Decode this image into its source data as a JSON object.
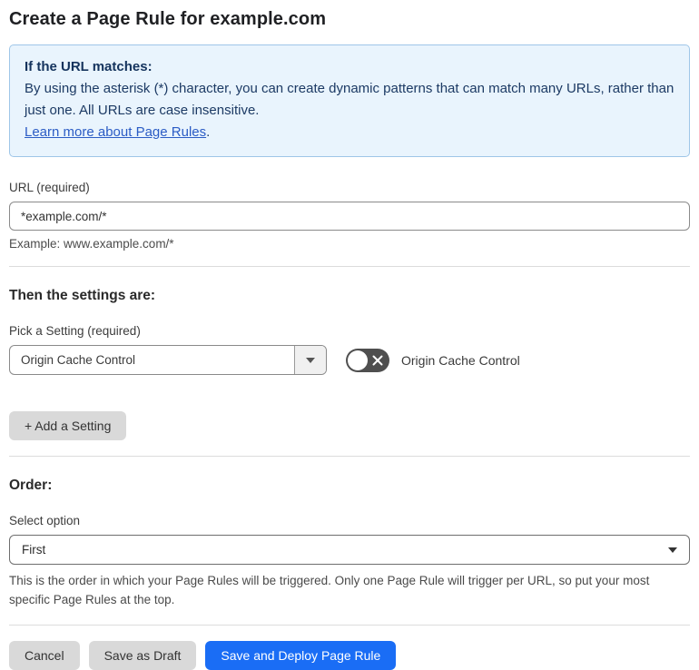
{
  "page": {
    "title": "Create a Page Rule for example.com"
  },
  "info_box": {
    "heading": "If the URL matches:",
    "body": "By using the asterisk (*) character, you can create dynamic patterns that can match many URLs, rather than just one. All URLs are case insensitive.",
    "link_label": "Learn more about Page Rules",
    "link_suffix": "."
  },
  "url_section": {
    "label": "URL (required)",
    "value": "*example.com/*",
    "helper": "Example: www.example.com/*"
  },
  "settings_section": {
    "heading": "Then the settings are:",
    "picker_label": "Pick a Setting (required)",
    "picker_value": "Origin Cache Control",
    "toggle_label": "Origin Cache Control",
    "toggle_state": "off",
    "add_button_label": "+ Add a Setting"
  },
  "order_section": {
    "heading": "Order:",
    "select_label": "Select option",
    "select_value": "First",
    "helper": "This is the order in which your Page Rules will be triggered. Only one Page Rule will trigger per URL, so put your most specific Page Rules at the top."
  },
  "footer": {
    "cancel_label": "Cancel",
    "save_draft_label": "Save as Draft",
    "save_deploy_label": "Save and Deploy Page Rule"
  },
  "colors": {
    "info_box_background": "#e9f4fd",
    "info_box_border": "#9fc6e8",
    "info_box_text": "#1c3a64",
    "link_blue": "#2b5cc5",
    "primary_button_blue": "#1a6df5",
    "toggle_off_gray": "#4f4f4f",
    "secondary_button_gray": "#d9d9d9"
  }
}
